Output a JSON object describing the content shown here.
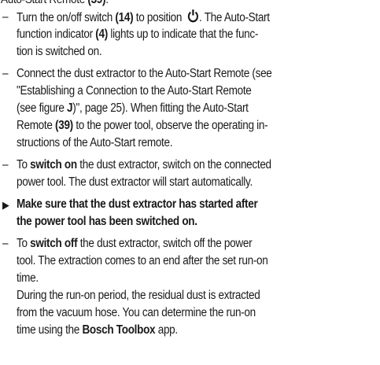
{
  "intro": {
    "text_a": "Auto-Start Remote ",
    "ref": "(39)",
    "text_b": "."
  },
  "step1": {
    "bullet": "–",
    "a": "Turn the on/off switch ",
    "ref_switch": "(14)",
    "b": " to position ",
    "c": ". The Auto-Start",
    "line2_a": "function indicator ",
    "ref_indicator": "(4)",
    "line2_b": " lights up to indicate that the func-",
    "line3": "tion is switched on."
  },
  "step2": {
    "bullet": "–",
    "line1": "Connect the dust extractor to the Auto-Start Remote (see",
    "line2": "\"Establishing a Connection to the Auto-Start Remote",
    "line3_a": "(see figure ",
    "figure_ref": "J",
    "line3_b": ")\", page 25). When fitting the Auto-Start",
    "line4_a": "Remote ",
    "ref_remote": "(39)",
    "line4_b": " to the power tool, observe the operating in-",
    "line5": "structions of the Auto-Start remote."
  },
  "step3": {
    "bullet": "–",
    "a": "To ",
    "bold": "switch on",
    "b": " the dust extractor, switch on the connected",
    "line2": "power tool. The dust extractor will start automatically."
  },
  "note": {
    "marker": "▶",
    "line1": "Make sure that the dust extractor has started after",
    "line2": "the power tool has been switched on."
  },
  "step4": {
    "bullet": "–",
    "a": "To ",
    "bold": "switch off",
    "b": " the dust extractor, switch off the power",
    "line2": "tool. The extraction comes to an end after the set run-on",
    "line3": "time.",
    "line4": "During the run-on period, the residual dust is extracted",
    "line5": "from the vacuum hose. You can determine the run-on",
    "line6_a": "time using the ",
    "app_name": "Bosch Toolbox",
    "line6_b": " app."
  },
  "icons": {
    "power": "power-symbol-icon"
  }
}
